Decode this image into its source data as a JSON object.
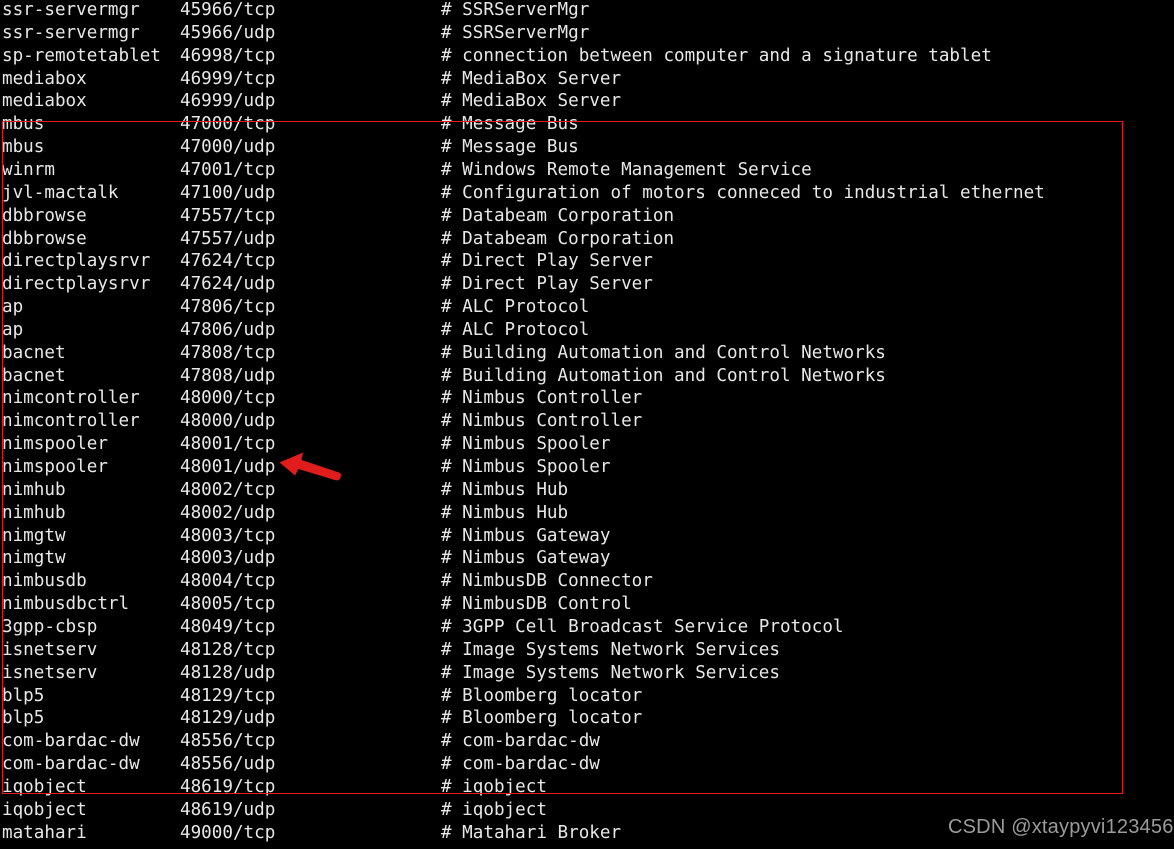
{
  "terminal": {
    "kind": "etc-services-file-listing",
    "background_color": "#000000",
    "text_color": "#e8e8e8",
    "lines": [
      {
        "name": "ssr-servermgr",
        "port": "45966/tcp",
        "comment": "# SSRServerMgr"
      },
      {
        "name": "ssr-servermgr",
        "port": "45966/udp",
        "comment": "# SSRServerMgr"
      },
      {
        "name": "sp-remotetablet",
        "port": "46998/tcp",
        "comment": "# connection between computer and a signature tablet"
      },
      {
        "name": "mediabox",
        "port": "46999/tcp",
        "comment": "# MediaBox Server"
      },
      {
        "name": "mediabox",
        "port": "46999/udp",
        "comment": "# MediaBox Server"
      },
      {
        "name": "mbus",
        "port": "47000/tcp",
        "comment": "# Message Bus"
      },
      {
        "name": "mbus",
        "port": "47000/udp",
        "comment": "# Message Bus"
      },
      {
        "name": "winrm",
        "port": "47001/tcp",
        "comment": "# Windows Remote Management Service"
      },
      {
        "name": "jvl-mactalk",
        "port": "47100/udp",
        "comment": "# Configuration of motors conneced to industrial ethernet"
      },
      {
        "name": "dbbrowse",
        "port": "47557/tcp",
        "comment": "# Databeam Corporation"
      },
      {
        "name": "dbbrowse",
        "port": "47557/udp",
        "comment": "# Databeam Corporation"
      },
      {
        "name": "directplaysrvr",
        "port": "47624/tcp",
        "comment": "# Direct Play Server"
      },
      {
        "name": "directplaysrvr",
        "port": "47624/udp",
        "comment": "# Direct Play Server"
      },
      {
        "name": "ap",
        "port": "47806/tcp",
        "comment": "# ALC Protocol"
      },
      {
        "name": "ap",
        "port": "47806/udp",
        "comment": "# ALC Protocol"
      },
      {
        "name": "bacnet",
        "port": "47808/tcp",
        "comment": "# Building Automation and Control Networks"
      },
      {
        "name": "bacnet",
        "port": "47808/udp",
        "comment": "# Building Automation and Control Networks"
      },
      {
        "name": "nimcontroller",
        "port": "48000/tcp",
        "comment": "# Nimbus Controller"
      },
      {
        "name": "nimcontroller",
        "port": "48000/udp",
        "comment": "# Nimbus Controller"
      },
      {
        "name": "nimspooler",
        "port": "48001/tcp",
        "comment": "# Nimbus Spooler"
      },
      {
        "name": "nimspooler",
        "port": "48001/udp",
        "comment": "# Nimbus Spooler"
      },
      {
        "name": "nimhub",
        "port": "48002/tcp",
        "comment": "# Nimbus Hub"
      },
      {
        "name": "nimhub",
        "port": "48002/udp",
        "comment": "# Nimbus Hub"
      },
      {
        "name": "nimgtw",
        "port": "48003/tcp",
        "comment": "# Nimbus Gateway"
      },
      {
        "name": "nimgtw",
        "port": "48003/udp",
        "comment": "# Nimbus Gateway"
      },
      {
        "name": "nimbusdb",
        "port": "48004/tcp",
        "comment": "# NimbusDB Connector"
      },
      {
        "name": "nimbusdbctrl",
        "port": "48005/tcp",
        "comment": "# NimbusDB Control"
      },
      {
        "name": "3gpp-cbsp",
        "port": "48049/tcp",
        "comment": "# 3GPP Cell Broadcast Service Protocol"
      },
      {
        "name": "isnetserv",
        "port": "48128/tcp",
        "comment": "# Image Systems Network Services"
      },
      {
        "name": "isnetserv",
        "port": "48128/udp",
        "comment": "# Image Systems Network Services"
      },
      {
        "name": "blp5",
        "port": "48129/tcp",
        "comment": "# Bloomberg locator"
      },
      {
        "name": "blp5",
        "port": "48129/udp",
        "comment": "# Bloomberg locator"
      },
      {
        "name": "com-bardac-dw",
        "port": "48556/tcp",
        "comment": "# com-bardac-dw"
      },
      {
        "name": "com-bardac-dw",
        "port": "48556/udp",
        "comment": "# com-bardac-dw"
      },
      {
        "name": "iqobject",
        "port": "48619/tcp",
        "comment": "# iqobject"
      },
      {
        "name": "iqobject",
        "port": "48619/udp",
        "comment": "# iqobject"
      },
      {
        "name": "matahari",
        "port": "49000/tcp",
        "comment": "# Matahari Broker"
      }
    ]
  },
  "annotations": {
    "highlight_rect": {
      "color": "#e01c1c",
      "first_line": "mbus 47000/tcp",
      "last_line": "iqobject 48619/tcp"
    },
    "arrow": {
      "color": "#e01c1c",
      "direction": "left",
      "points_at": "nimspooler 48001/udp"
    }
  },
  "watermark": {
    "text": "CSDN @xtaypyvi123456",
    "color": "#9b9b9b"
  }
}
